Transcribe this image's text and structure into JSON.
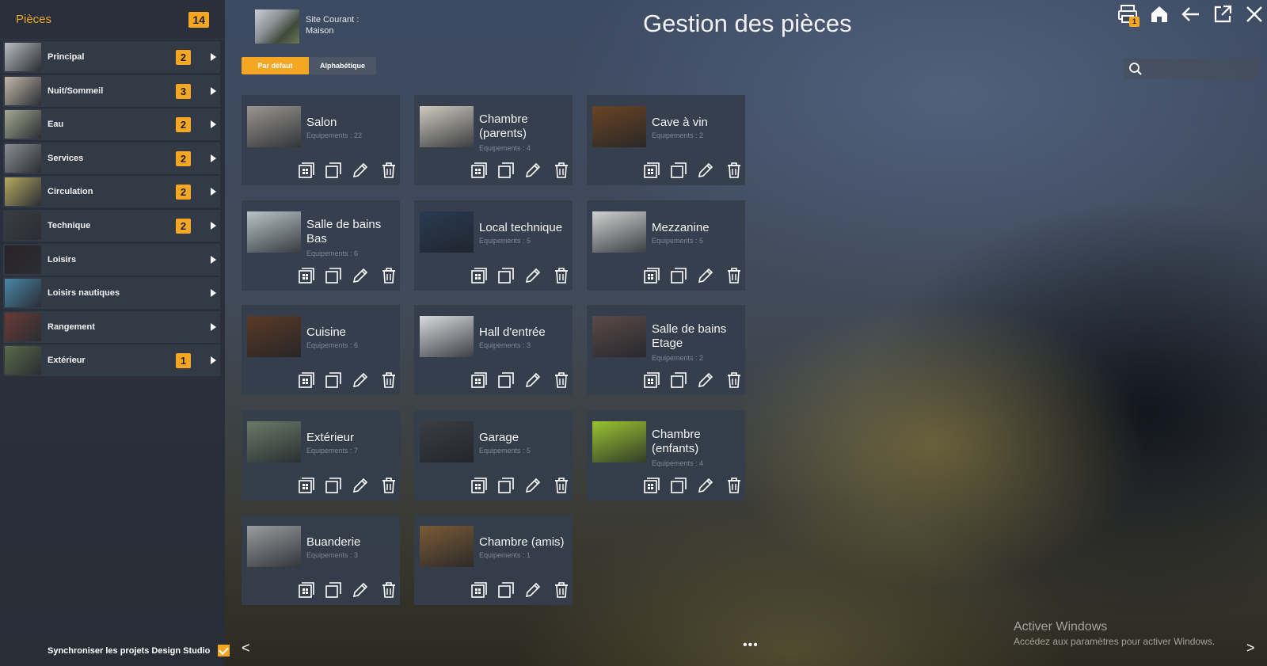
{
  "sidebar": {
    "title": "Pièces",
    "count": "14",
    "items": [
      {
        "label": "Principal",
        "badge": "2",
        "thumb": "#b9bcc0"
      },
      {
        "label": "Nuit/Sommeil",
        "badge": "3",
        "thumb": "#c2b8a8"
      },
      {
        "label": "Eau",
        "badge": "2",
        "thumb": "#a4a890"
      },
      {
        "label": "Services",
        "badge": "2",
        "thumb": "#8a8d90"
      },
      {
        "label": "Circulation",
        "badge": "2",
        "thumb": "#b8a860"
      },
      {
        "label": "Technique",
        "badge": "2",
        "thumb": "#3a3d40"
      },
      {
        "label": "Loisirs",
        "badge": "",
        "thumb": "#2a2226"
      },
      {
        "label": "Loisirs nautiques",
        "badge": "",
        "thumb": "#4a86a8"
      },
      {
        "label": "Rangement",
        "badge": "",
        "thumb": "#6a3a34"
      },
      {
        "label": "Extérieur",
        "badge": "1",
        "thumb": "#5a6a48"
      }
    ],
    "sync_label": "Synchroniser les projets Design Studio",
    "sync_checked": true
  },
  "header": {
    "site_line1": "Site Courant :",
    "site_line2": "Maison",
    "title": "Gestion des pièces",
    "sort_default": "Par défaut",
    "sort_alpha": "Alphabétique",
    "notif_count": "1",
    "search_placeholder": ""
  },
  "rooms": [
    {
      "name": "Salon",
      "equip": "Equipements : 22",
      "color": "#9a9690"
    },
    {
      "name": "Chambre (parents)",
      "equip": "Equipements : 4",
      "color": "#cfcac0"
    },
    {
      "name": "Cave à vin",
      "equip": "Equipements : 2",
      "color": "#6a4424"
    },
    {
      "name": "Salle de bains Bas",
      "equip": "Equipements : 6",
      "color": "#b8c4c8"
    },
    {
      "name": "Local technique",
      "equip": "Equipements : 5",
      "color": "#2a3a52"
    },
    {
      "name": "Mezzanine",
      "equip": "Equipements : 5",
      "color": "#d0d2d0"
    },
    {
      "name": "Cuisine",
      "equip": "Equipements : 6",
      "color": "#5a3a26"
    },
    {
      "name": "Hall d'entrée",
      "equip": "Equipements : 3",
      "color": "#d8dadc"
    },
    {
      "name": "Salle de bains Etage",
      "equip": "Equipements : 2",
      "color": "#5a4a48"
    },
    {
      "name": "Extérieur",
      "equip": "Equipements : 7",
      "color": "#6a7a68"
    },
    {
      "name": "Garage",
      "equip": "Equipements : 5",
      "color": "#3a3e42"
    },
    {
      "name": "Chambre (enfants)",
      "equip": "Equipements : 4",
      "color": "#9ac430"
    },
    {
      "name": "Buanderie",
      "equip": "Equipements : 3",
      "color": "#9a9c9e"
    },
    {
      "name": "Chambre (amis)",
      "equip": "Equipements : 1",
      "color": "#7a5a36"
    }
  ],
  "pager": {
    "prev": "<",
    "dots": "•••",
    "next": ">"
  },
  "watermark": {
    "title": "Activer Windows",
    "subtitle": "Accédez aux paramètres pour activer Windows."
  },
  "colors": {
    "accent": "#f5a623"
  }
}
